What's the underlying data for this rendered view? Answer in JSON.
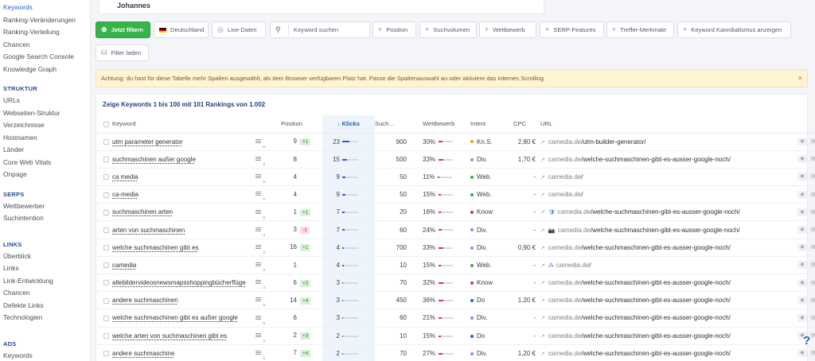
{
  "sidebar": {
    "top_items": [
      {
        "label": "Keywords",
        "active": true
      },
      {
        "label": "Ranking-Veränderungen"
      },
      {
        "label": "Ranking-Verteilung"
      },
      {
        "label": "Chancen"
      },
      {
        "label": "Google Search Console"
      },
      {
        "label": "Knowledge Graph"
      }
    ],
    "struktur_title": "STRUKTUR",
    "struktur_items": [
      "URLs",
      "Webseiten-Struktur",
      "Verzeichnisse",
      "Hostnamen",
      "Länder",
      "Core Web Vitals",
      "Onpage"
    ],
    "serps_title": "SERPS",
    "serps_items": [
      "Wettbewerber",
      "Suchintention"
    ],
    "links_title": "LINKS",
    "links_items": [
      "Überblick",
      "Links",
      "Link-Entwicklung",
      "Chancen",
      "Defekte Links",
      "Technologien"
    ],
    "ads_title": "ADS",
    "ads_items": [
      "Keywords"
    ]
  },
  "header": {
    "tab_title": "Johannes"
  },
  "filters": {
    "apply_label": "Jetzt filtern",
    "country_label": "Deutschland",
    "live_label": "Live-Daten",
    "search_placeholder": "Keyword suchen",
    "position_label": "Position",
    "suchvolumen_label": "Suchvolumen",
    "wettbewerb_label": "Wettbewerb",
    "serp_label": "SERP-Features",
    "treffer_label": "Treffer-Merkmale",
    "kannibal_label": "Keyword Kannibalismus anzeigen",
    "load_label": "Filter laden"
  },
  "notice": {
    "text": "Achtung: du hast für diese Tabelle mehr Spalten ausgewählt, als dein Browser verfügbaren Platz hat. Passe die Spaltenauswahl an oder aktiviere das internes Scrolling."
  },
  "table": {
    "summary": "Zeige Keywords 1 bis 100 mit 101 Rankings von 1.002",
    "headers": {
      "keyword": "Keyword",
      "position": "Position",
      "klicks": "Klicks",
      "such": "Such...",
      "wettbewerb": "Wettbewerb",
      "intent": "Intent",
      "cpc": "CPC",
      "url": "URL"
    },
    "intent_colors": {
      "Kn.S.": "#f0a020",
      "Div.": "#b07ee0",
      "Web.": "#3aa845",
      "Know": "#d63340",
      "Do": "#2b62c9"
    },
    "rows": [
      {
        "keyword": "utm parameter generator",
        "serp": "5",
        "position": "9",
        "delta": "+1",
        "delta_dir": "up",
        "klicks": "23",
        "klicks_frac": 0.45,
        "volume": "900",
        "wettbewerb": "30%",
        "wb_frac": 0.3,
        "intent": "Kn.S.",
        "cpc": "2,80 €",
        "url_domain": "camedia.de",
        "url_path": "/utm-builder-generator/",
        "url_icon": ""
      },
      {
        "keyword": "suchmaschinen außer google",
        "serp": "5",
        "position": "8",
        "delta": "",
        "delta_dir": "",
        "klicks": "15",
        "klicks_frac": 0.3,
        "volume": "500",
        "wettbewerb": "33%",
        "wb_frac": 0.33,
        "intent": "Div.",
        "cpc": "1,70 €",
        "url_domain": "camedia.de",
        "url_path": "/welche-suchmaschinen-gibt-es-ausser-google-noch/",
        "url_icon": ""
      },
      {
        "keyword": "ca media",
        "serp": "5",
        "position": "4",
        "delta": "",
        "delta_dir": "",
        "klicks": "9",
        "klicks_frac": 0.18,
        "volume": "50",
        "wettbewerb": "11%",
        "wb_frac": 0.11,
        "intent": "Web.",
        "cpc": "-",
        "url_domain": "camedia.de",
        "url_path": "/",
        "url_icon": ""
      },
      {
        "keyword": "ca-media",
        "serp": "5",
        "position": "4",
        "delta": "",
        "delta_dir": "",
        "klicks": "9",
        "klicks_frac": 0.18,
        "volume": "50",
        "wettbewerb": "15%",
        "wb_frac": 0.15,
        "intent": "Web.",
        "cpc": "-",
        "url_domain": "camedia.de",
        "url_path": "/",
        "url_icon": ""
      },
      {
        "keyword": "suchmaschinen arten",
        "serp": "5",
        "position": "1",
        "delta": "+1",
        "delta_dir": "up",
        "klicks": "7",
        "klicks_frac": 0.14,
        "volume": "20",
        "wettbewerb": "16%",
        "wb_frac": 0.16,
        "intent": "Know",
        "cpc": "-",
        "url_domain": "camedia.de",
        "url_path": "/welche-suchmaschinen-gibt-es-ausser-google-noch/",
        "url_icon": "🛡"
      },
      {
        "keyword": "arten von suchmaschinen",
        "serp": "4",
        "position": "3",
        "delta": "-1",
        "delta_dir": "down",
        "klicks": "7",
        "klicks_frac": 0.14,
        "volume": "60",
        "wettbewerb": "24%",
        "wb_frac": 0.24,
        "intent": "Div.",
        "cpc": "-",
        "url_domain": "camedia.de",
        "url_path": "/welche-suchmaschinen-gibt-es-ausser-google-noch/",
        "url_icon": "📷"
      },
      {
        "keyword": "welche suchmaschinen gibt es",
        "serp": "4",
        "position": "16",
        "delta": "+1",
        "delta_dir": "up",
        "klicks": "4",
        "klicks_frac": 0.08,
        "volume": "700",
        "wettbewerb": "33%",
        "wb_frac": 0.33,
        "intent": "Div.",
        "cpc": "0,90 €",
        "url_domain": "camedia.de",
        "url_path": "/welche-suchmaschinen-gibt-es-ausser-google-noch/",
        "url_icon": ""
      },
      {
        "keyword": "camedia",
        "serp": "5",
        "position": "1",
        "delta": "",
        "delta_dir": "",
        "klicks": "4",
        "klicks_frac": 0.08,
        "volume": "10",
        "wettbewerb": "15%",
        "wb_frac": 0.15,
        "intent": "Web.",
        "cpc": "-",
        "url_domain": "camedia.de",
        "url_path": "/",
        "url_icon": "⁂"
      },
      {
        "keyword": "allebildervideosnewsmapsshoppingbücherflüge",
        "serp": "3",
        "position": "6",
        "delta": "+2",
        "delta_dir": "up",
        "klicks": "3",
        "klicks_frac": 0.06,
        "volume": "70",
        "wettbewerb": "32%",
        "wb_frac": 0.32,
        "intent": "Know",
        "cpc": "-",
        "url_domain": "camedia.de",
        "url_path": "/welche-suchmaschinen-gibt-es-ausser-google-noch/",
        "url_icon": ""
      },
      {
        "keyword": "andere suchmaschinen",
        "serp": "5",
        "position": "14",
        "delta": "+4",
        "delta_dir": "up",
        "klicks": "3",
        "klicks_frac": 0.06,
        "volume": "450",
        "wettbewerb": "36%",
        "wb_frac": 0.36,
        "intent": "Do",
        "cpc": "1,20 €",
        "url_domain": "camedia.de",
        "url_path": "/welche-suchmaschinen-gibt-es-ausser-google-noch/",
        "url_icon": ""
      },
      {
        "keyword": "welche suchmaschinen gibt es außer google",
        "serp": "5",
        "position": "6",
        "delta": "",
        "delta_dir": "",
        "klicks": "3",
        "klicks_frac": 0.06,
        "volume": "60",
        "wettbewerb": "21%",
        "wb_frac": 0.21,
        "intent": "Div.",
        "cpc": "-",
        "url_domain": "camedia.de",
        "url_path": "/welche-suchmaschinen-gibt-es-ausser-google-noch/",
        "url_icon": ""
      },
      {
        "keyword": "welche arten von suchmaschinen gibt es",
        "serp": "4",
        "position": "2",
        "delta": "+3",
        "delta_dir": "up",
        "klicks": "2",
        "klicks_frac": 0.04,
        "volume": "10",
        "wettbewerb": "15%",
        "wb_frac": 0.15,
        "intent": "Do",
        "cpc": "-",
        "url_domain": "camedia.de",
        "url_path": "/welche-suchmaschinen-gibt-es-ausser-google-noch/",
        "url_icon": ""
      },
      {
        "keyword": "andere suchmaschine",
        "serp": "5",
        "position": "7",
        "delta": "+4",
        "delta_dir": "up",
        "klicks": "2",
        "klicks_frac": 0.04,
        "volume": "70",
        "wettbewerb": "27%",
        "wb_frac": 0.27,
        "intent": "Div.",
        "cpc": "1,20 €",
        "url_domain": "camedia.de",
        "url_path": "/welche-suchmaschinen-gibt-es-ausser-google-noch/",
        "url_icon": ""
      }
    ]
  },
  "help_label": "?"
}
